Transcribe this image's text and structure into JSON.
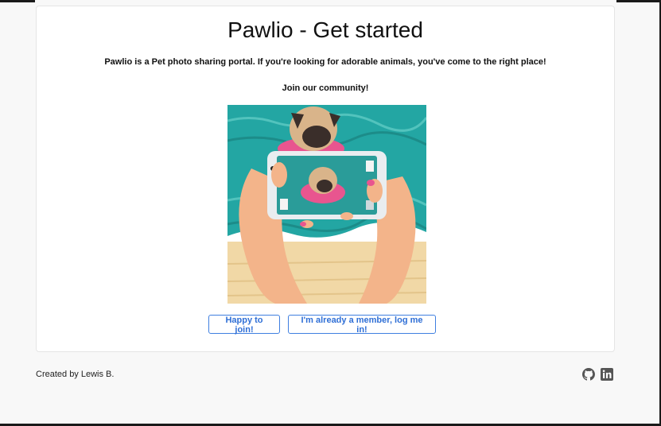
{
  "page": {
    "title": "Pawlio - Get started",
    "lead": "Pawlio is a Pet photo sharing portal. If you're looking for adorable animals, you've come to the right place!",
    "join_text": "Join our community!"
  },
  "hero": {
    "description_icon": "pug-photo-illustration-icon"
  },
  "buttons": {
    "join_label": "Happy to join!",
    "login_label": "I'm already a member, log me in!"
  },
  "footer": {
    "credit": "Created by Lewis B.",
    "icons": [
      "github-icon",
      "linkedin-icon"
    ]
  },
  "colors": {
    "accent": "#2f6fd6",
    "water": "#23a6a3",
    "sand": "#f1d8a6",
    "skin": "#f3b48a"
  }
}
